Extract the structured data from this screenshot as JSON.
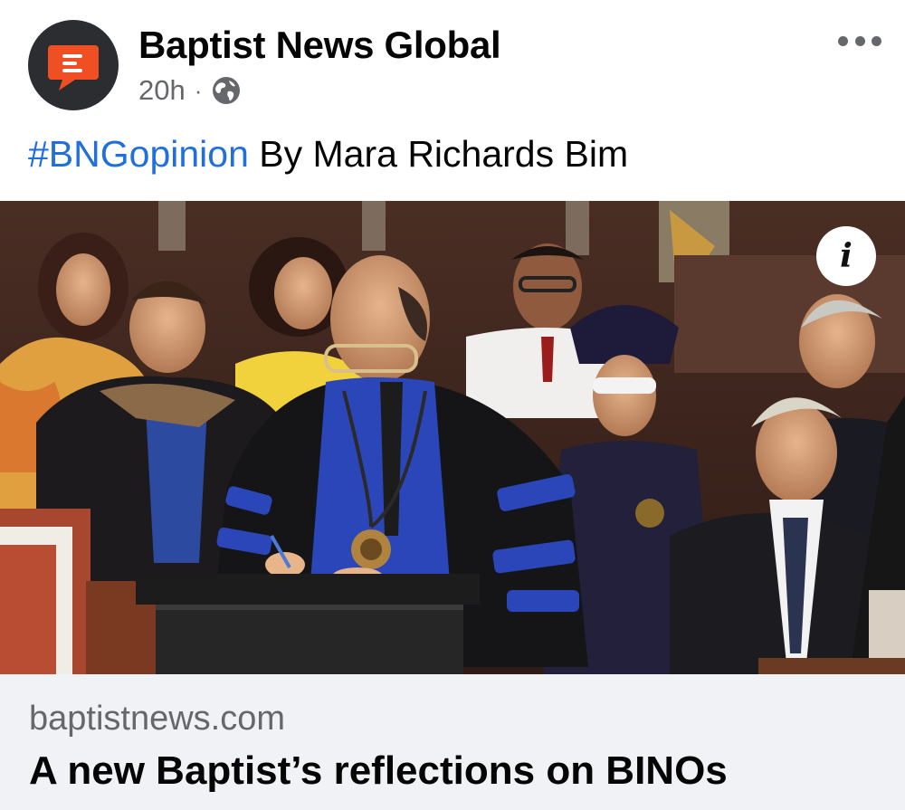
{
  "post": {
    "page_name": "Baptist News Global",
    "timestamp": "20h",
    "separator": "·",
    "audience_icon": "globe-icon",
    "more_icon": "ellipsis-icon",
    "hashtag": "#BNGopinion",
    "byline": " By Mara Richards Bim"
  },
  "photo": {
    "info_label": "i"
  },
  "link": {
    "domain": "baptistnews.com",
    "headline": "A new Baptist’s reflections on BINOs"
  },
  "colors": {
    "brand_orange": "#f04e23",
    "avatar_bg": "#2b2d31",
    "hashtag_blue": "#216fdb",
    "secondary_text": "#65676b",
    "card_bg": "#f0f2f5"
  }
}
